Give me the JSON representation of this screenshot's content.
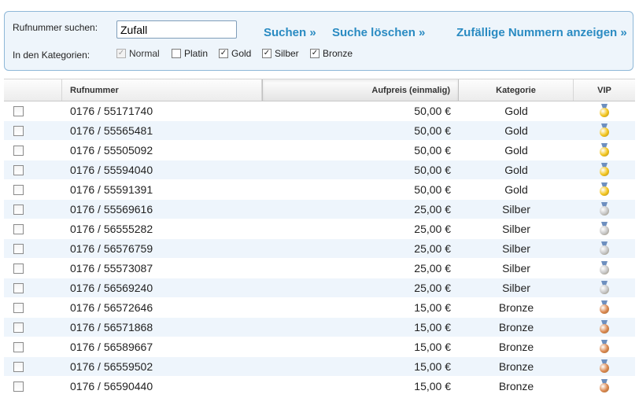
{
  "search": {
    "label": "Rufnummer suchen:",
    "value": "Zufall",
    "actions": {
      "search": "Suchen »",
      "clear": "Suche löschen »",
      "random": "Zufällige Nummern anzeigen »"
    },
    "categories_label": "In den Kategorien:",
    "categories": [
      {
        "label": "Normal",
        "checked": true,
        "disabled": true
      },
      {
        "label": "Platin",
        "checked": false,
        "disabled": false
      },
      {
        "label": "Gold",
        "checked": true,
        "disabled": false
      },
      {
        "label": "Silber",
        "checked": true,
        "disabled": false
      },
      {
        "label": "Bronze",
        "checked": true,
        "disabled": false
      }
    ]
  },
  "table": {
    "columns": {
      "number": "Rufnummer",
      "price": "Aufpreis (einmalig)",
      "category": "Kategorie",
      "vip": "VIP"
    },
    "rows": [
      {
        "number": "0176 / 55171740",
        "price": "50,00 €",
        "category": "Gold",
        "medal": "gold-medal-icon"
      },
      {
        "number": "0176 / 55565481",
        "price": "50,00 €",
        "category": "Gold",
        "medal": "gold-medal-icon"
      },
      {
        "number": "0176 / 55505092",
        "price": "50,00 €",
        "category": "Gold",
        "medal": "gold-medal-icon"
      },
      {
        "number": "0176 / 55594040",
        "price": "50,00 €",
        "category": "Gold",
        "medal": "gold-medal-icon"
      },
      {
        "number": "0176 / 55591391",
        "price": "50,00 €",
        "category": "Gold",
        "medal": "gold-medal-icon"
      },
      {
        "number": "0176 / 55569616",
        "price": "25,00 €",
        "category": "Silber",
        "medal": "silver-medal-icon"
      },
      {
        "number": "0176 / 56555282",
        "price": "25,00 €",
        "category": "Silber",
        "medal": "silver-medal-icon"
      },
      {
        "number": "0176 / 56576759",
        "price": "25,00 €",
        "category": "Silber",
        "medal": "silver-medal-icon"
      },
      {
        "number": "0176 / 55573087",
        "price": "25,00 €",
        "category": "Silber",
        "medal": "silver-medal-icon"
      },
      {
        "number": "0176 / 56569240",
        "price": "25,00 €",
        "category": "Silber",
        "medal": "silver-medal-icon"
      },
      {
        "number": "0176 / 56572646",
        "price": "15,00 €",
        "category": "Bronze",
        "medal": "bronze-medal-icon"
      },
      {
        "number": "0176 / 56571868",
        "price": "15,00 €",
        "category": "Bronze",
        "medal": "bronze-medal-icon"
      },
      {
        "number": "0176 / 56589667",
        "price": "15,00 €",
        "category": "Bronze",
        "medal": "bronze-medal-icon"
      },
      {
        "number": "0176 / 56559502",
        "price": "15,00 €",
        "category": "Bronze",
        "medal": "bronze-medal-icon"
      },
      {
        "number": "0176 / 56590440",
        "price": "15,00 €",
        "category": "Bronze",
        "medal": "bronze-medal-icon"
      }
    ]
  },
  "colors": {
    "link": "#2a8bc2",
    "panel_bg": "#eef5fb",
    "panel_border": "#8fb8d8",
    "row_alt": "#eef5fc",
    "gold": "#f2c318",
    "silver": "#c4c4c4",
    "bronze": "#d9844a"
  }
}
